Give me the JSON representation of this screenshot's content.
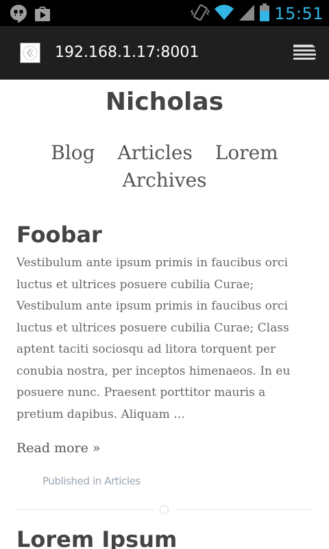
{
  "status_bar": {
    "time": "15:51",
    "left_icons": [
      "hangouts-icon",
      "play-store-icon"
    ],
    "right_icons": [
      "vibrate-icon",
      "wifi-icon",
      "signal-icon",
      "battery-icon"
    ],
    "accent_color": "#33b5e5"
  },
  "browser": {
    "url": "192.168.1.17:8001",
    "favicon": "site-favicon-icon",
    "menu_icon": "tabs-menu-icon"
  },
  "site": {
    "title": "Nicholas",
    "nav": [
      {
        "label": "Blog"
      },
      {
        "label": "Articles"
      },
      {
        "label": "Lorem"
      },
      {
        "label": "Archives"
      }
    ]
  },
  "posts": [
    {
      "title": "Foobar",
      "excerpt": "Vestibulum ante ipsum primis in faucibus orci luctus et ultrices posuere cubilia Curae; Vestibulum ante ipsum primis in faucibus orci luctus et ultrices posuere cubilia Curae; Class aptent taciti sociosqu ad litora torquent per conubia nostra, per inceptos himenaeos. In eu posuere nunc. Praesent porttitor mauris a pretium dapibus. Aliquam …",
      "read_more": "Read more »",
      "published": "Published in Articles"
    },
    {
      "title": "Lorem Ipsum"
    }
  ]
}
